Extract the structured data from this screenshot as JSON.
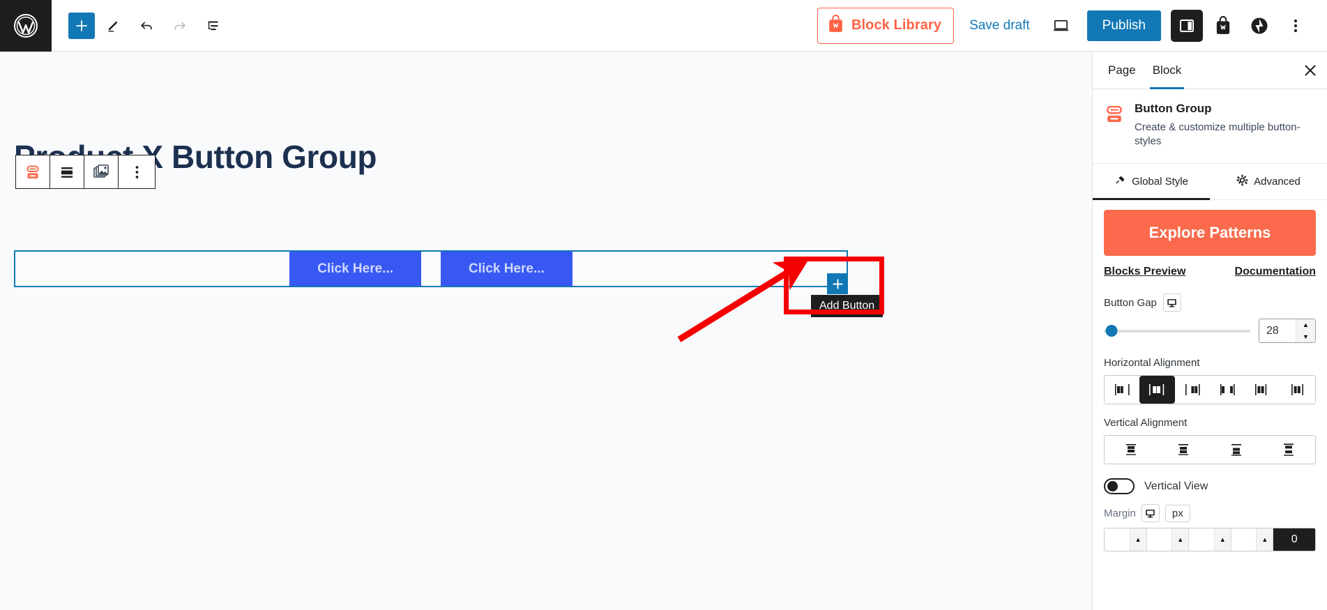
{
  "topbar": {
    "logo_icon": "wordpress-logo-icon",
    "add_block_icon": "plus-icon",
    "edit_icon": "pencil-icon",
    "undo_icon": "undo-arrow-icon",
    "redo_icon": "redo-arrow-icon",
    "list_view_icon": "document-outline-icon",
    "block_library_label": "Block Library",
    "block_library_icon": "shopping-bag-icon",
    "save_draft_label": "Save draft",
    "preview_icon": "desktop-preview-icon",
    "publish_label": "Publish",
    "settings_panel_icon": "sidebar-panel-icon",
    "cart_icon": "shopping-bag-icon",
    "plugin_icon": "jetpack-icon",
    "options_icon": "three-dots-vertical-icon",
    "accent_blue": "#1278b5",
    "accent_orange": "#ff6344"
  },
  "canvas": {
    "page_title": "Product X Button Group",
    "block_toolbar": {
      "items": [
        {
          "icon": "button-group-block-icon",
          "name": "block-type-button"
        },
        {
          "icon": "align-center-icon",
          "name": "align-button"
        },
        {
          "icon": "images-stack-icon",
          "name": "media-button"
        },
        {
          "icon": "three-dots-vertical-icon",
          "name": "more-options-button"
        }
      ]
    },
    "buttons": [
      {
        "label": "Click Here..."
      },
      {
        "label": "Click Here..."
      }
    ],
    "add_button_icon": "plus-icon",
    "add_button_tooltip": "Add Button",
    "selection_color": "#1278b5",
    "button_color": "#3858f3",
    "annotation_color": "#f50000"
  },
  "sidebar": {
    "tabs": [
      {
        "label": "Page",
        "active": false
      },
      {
        "label": "Block",
        "active": true
      }
    ],
    "close_icon": "close-icon",
    "block": {
      "icon": "button-group-block-icon",
      "title": "Button Group",
      "description": "Create & customize multiple button-styles"
    },
    "style_tabs": [
      {
        "label": "Global Style",
        "icon": "pin-icon",
        "active": true
      },
      {
        "label": "Advanced",
        "icon": "gear-icon",
        "active": false
      }
    ],
    "explore_patterns_label": "Explore Patterns",
    "links": [
      {
        "label": "Blocks Preview"
      },
      {
        "label": "Documentation"
      }
    ],
    "button_gap": {
      "label": "Button Gap",
      "device_icon": "desktop-icon",
      "value": "28",
      "slider_percent": 5
    },
    "horizontal_alignment": {
      "label": "Horizontal Alignment",
      "options": [
        {
          "name": "align-left",
          "active": false
        },
        {
          "name": "align-center",
          "active": true
        },
        {
          "name": "align-right",
          "active": false
        },
        {
          "name": "space-between",
          "active": false
        },
        {
          "name": "space-around",
          "active": false
        },
        {
          "name": "space-evenly",
          "active": false
        }
      ]
    },
    "vertical_alignment": {
      "label": "Vertical Alignment",
      "options": [
        {
          "name": "valign-top",
          "active": false
        },
        {
          "name": "valign-middle",
          "active": false
        },
        {
          "name": "valign-bottom",
          "active": false
        },
        {
          "name": "valign-stretch",
          "active": false
        }
      ]
    },
    "vertical_view": {
      "label": "Vertical View",
      "enabled": false
    },
    "margin": {
      "label": "Margin",
      "device_icon": "desktop-icon",
      "unit": "px",
      "values": [
        "",
        "",
        "",
        "",
        "0"
      ]
    },
    "accent_orange": "#fb6a4d"
  }
}
